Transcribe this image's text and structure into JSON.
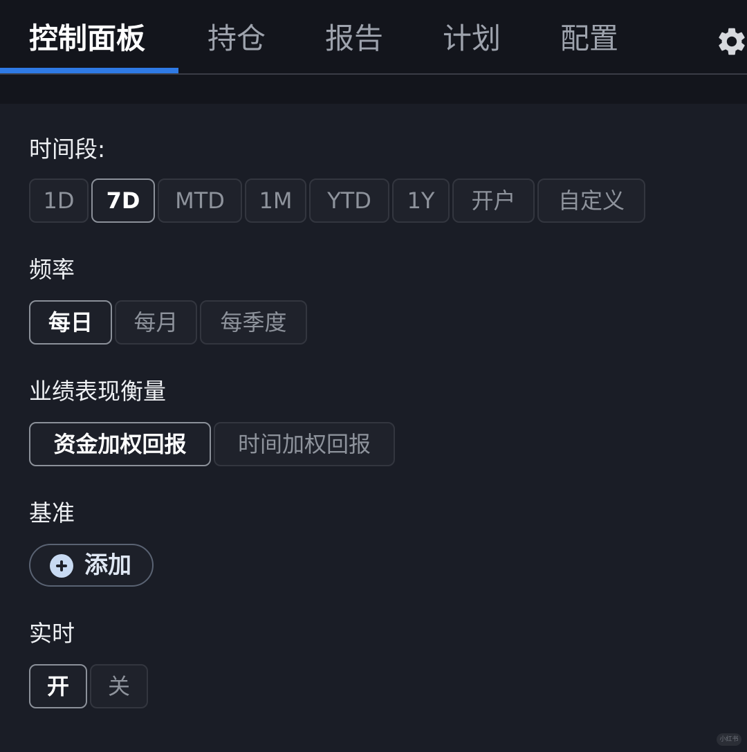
{
  "tabs": [
    {
      "label": "控制面板",
      "active": true
    },
    {
      "label": "持仓",
      "active": false
    },
    {
      "label": "报告",
      "active": false
    },
    {
      "label": "计划",
      "active": false
    },
    {
      "label": "配置",
      "active": false
    }
  ],
  "settings_icon": "gear-icon",
  "accent_color": "#2f7ae5",
  "period": {
    "label": "时间段:",
    "options": [
      "1D",
      "7D",
      "MTD",
      "1M",
      "YTD",
      "1Y",
      "开户",
      "自定义"
    ],
    "selected": "7D"
  },
  "frequency": {
    "label": "频率",
    "options": [
      "每日",
      "每月",
      "每季度"
    ],
    "selected": "每日"
  },
  "performance": {
    "label": "业绩表现衡量",
    "options": [
      "资金加权回报",
      "时间加权回报"
    ],
    "selected": "资金加权回报"
  },
  "benchmark": {
    "label": "基准",
    "add_label": "添加",
    "add_icon": "plus-circle-icon"
  },
  "realtime": {
    "label": "实时",
    "options": [
      "开",
      "关"
    ],
    "selected": "开"
  },
  "watermark": "小红书"
}
